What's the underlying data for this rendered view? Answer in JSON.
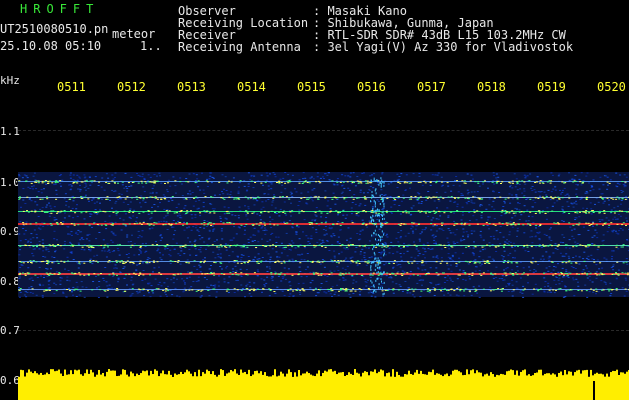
{
  "left": {
    "brand": "HROFFT",
    "filename": "UT2510080510.pn",
    "meteor": "meteor",
    "datetime": "25.10.08 05:10",
    "index": "1.."
  },
  "info": [
    {
      "label": "Observer",
      "value": ": Masaki Kano"
    },
    {
      "label": "Receiving Location",
      "value": ": Shibukawa, Gunma, Japan"
    },
    {
      "label": "Receiver",
      "value": ": RTL-SDR SDR# 43dB L15 103.2MHz CW"
    },
    {
      "label": "Receiving Antenna",
      "value": ": 3el Yagi(V) Az 330 for Vladivostok"
    }
  ],
  "time_ticks": [
    "0511",
    "0512",
    "0513",
    "0514",
    "0515",
    "0516",
    "0517",
    "0518",
    "0519",
    "0520"
  ],
  "freq_axis": {
    "unit": "kHz",
    "labels": [
      "1.1",
      "1.0",
      "0.9",
      "0.8",
      "0.7",
      "0.6"
    ]
  },
  "colors": {
    "tick": "#ffff30",
    "brand": "#38e838",
    "band": "#0a1a6a",
    "amp": "#ffee00"
  }
}
